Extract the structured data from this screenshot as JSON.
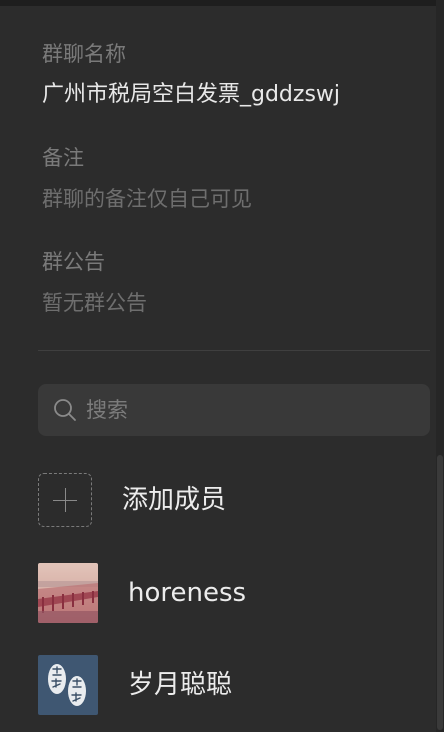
{
  "group": {
    "name_label": "群聊名称",
    "name_value": "广州市税局空白发票_gddzswj",
    "remark_label": "备注",
    "remark_placeholder": "群聊的备注仅自己可见",
    "notice_label": "群公告",
    "notice_value": "暂无群公告"
  },
  "search": {
    "placeholder": "搜索",
    "icon": "search-icon"
  },
  "members": {
    "add_label": "添加成员",
    "list": [
      {
        "name": "horeness",
        "avatar": "photo-avatar"
      },
      {
        "name": "岁月聪聪",
        "avatar": "calligraphy-avatar"
      }
    ]
  },
  "colors": {
    "background": "#2c2c2c",
    "label": "#7a7a7a",
    "value": "#e8e8e8",
    "search_bg": "#393939"
  }
}
